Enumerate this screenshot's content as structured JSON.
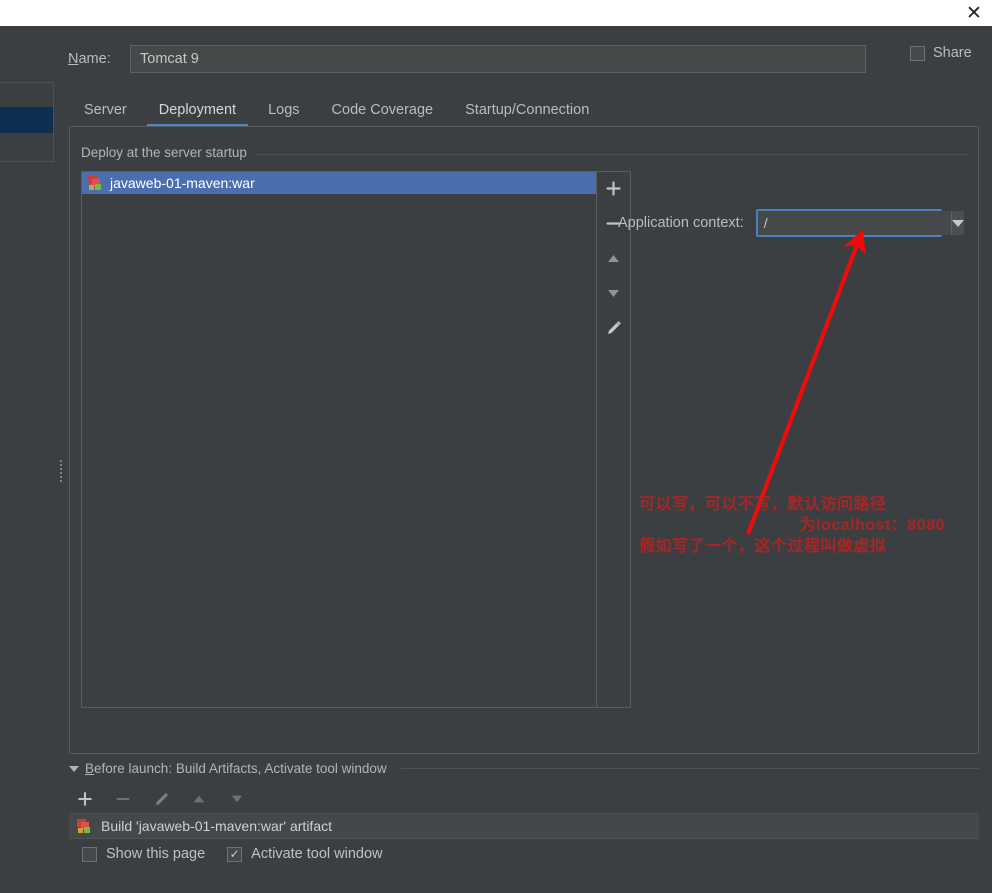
{
  "window": {
    "close_label": "✕"
  },
  "name_field": {
    "label_prefix": "N",
    "label_rest": "ame:",
    "value": "Tomcat 9"
  },
  "share": {
    "label": "Share",
    "checked": false
  },
  "tabs": [
    {
      "label": "Server",
      "active": false
    },
    {
      "label": "Deployment",
      "active": true
    },
    {
      "label": "Logs",
      "active": false
    },
    {
      "label": "Code Coverage",
      "active": false
    },
    {
      "label": "Startup/Connection",
      "active": false
    }
  ],
  "deploy_section": {
    "title": "Deploy at the server startup",
    "items": [
      {
        "label": "javaweb-01-maven:war",
        "icon": "war-artifact-icon",
        "selected": true
      }
    ],
    "toolbar": [
      {
        "name": "add-button",
        "icon": "plus-icon",
        "enabled": true
      },
      {
        "name": "remove-button",
        "icon": "minus-icon",
        "enabled": true
      },
      {
        "name": "move-up-button",
        "icon": "arrow-up-icon",
        "enabled": true
      },
      {
        "name": "move-down-button",
        "icon": "arrow-down-icon",
        "enabled": true
      },
      {
        "name": "edit-button",
        "icon": "pencil-icon",
        "enabled": true
      }
    ]
  },
  "application_context": {
    "label": "Application context:",
    "value": "/",
    "placeholder": ""
  },
  "annotation": {
    "line1": "可以写，可以不写，默认访问路径",
    "line2": "为localhost：8080",
    "line3": "假如写了一个，这个过程叫做虚拟",
    "color": "#c22020"
  },
  "before_launch": {
    "title_prefix": "B",
    "title_rest": "efore launch: Build Artifacts, Activate tool window",
    "toolbar": [
      {
        "name": "add-task-button",
        "icon": "plus-icon",
        "enabled": true
      },
      {
        "name": "remove-task-button",
        "icon": "minus-icon",
        "enabled": false
      },
      {
        "name": "edit-task-button",
        "icon": "pencil-icon",
        "enabled": false
      },
      {
        "name": "task-move-up-button",
        "icon": "arrow-up-icon",
        "enabled": false
      },
      {
        "name": "task-move-down-button",
        "icon": "arrow-down-icon",
        "enabled": false
      }
    ],
    "task": {
      "label": "Build 'javaweb-01-maven:war' artifact",
      "icon": "war-artifact-icon"
    },
    "checkboxes": [
      {
        "label": "Show this page",
        "checked": false
      },
      {
        "label": "Activate tool window",
        "checked": true
      }
    ]
  },
  "theme": {
    "background": "#3c3f41",
    "selection_blue": "#4b6eaf",
    "accent_blue": "#4a88c7",
    "focus_border": "#4b7fc4"
  }
}
